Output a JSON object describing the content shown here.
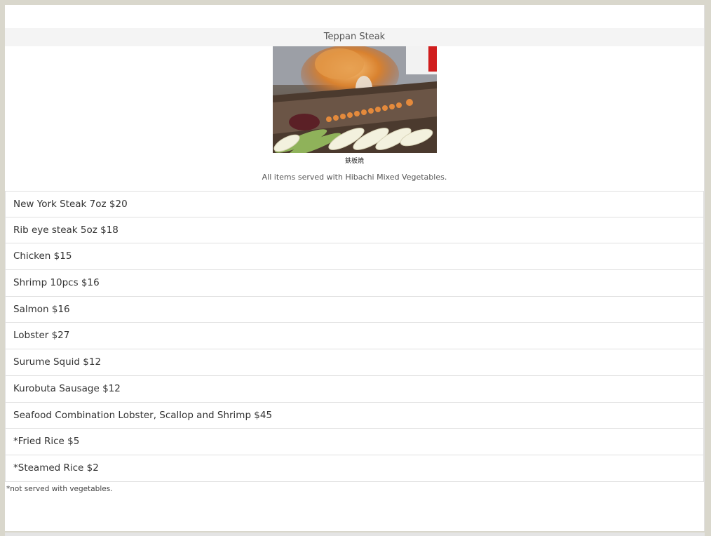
{
  "section": {
    "title": "Teppan Steak",
    "image_caption": "鉄板焼",
    "note": "All items served with Hibachi Mixed Vegetables."
  },
  "menu": {
    "items": [
      {
        "label": "New York Steak 7oz $20"
      },
      {
        "label": "Rib eye steak 5oz $18"
      },
      {
        "label": "Chicken $15"
      },
      {
        "label": "Shrimp 10pcs $16"
      },
      {
        "label": "Salmon $16"
      },
      {
        "label": "Lobster $27"
      },
      {
        "label": "Surume Squid $12"
      },
      {
        "label": "Kurobuta Sausage $12"
      },
      {
        "label": "Seafood Combination Lobster, Scallop and Shrimp $45"
      },
      {
        "label": "*Fried Rice $5"
      },
      {
        "label": "*Steamed Rice $2"
      }
    ],
    "footnote": "*not served with vegetables."
  },
  "colors": {
    "page_background": "#d9d7cc",
    "panel_background": "#ffffff",
    "title_bar": "#f4f4f4",
    "row_border": "#e0e0e0"
  }
}
